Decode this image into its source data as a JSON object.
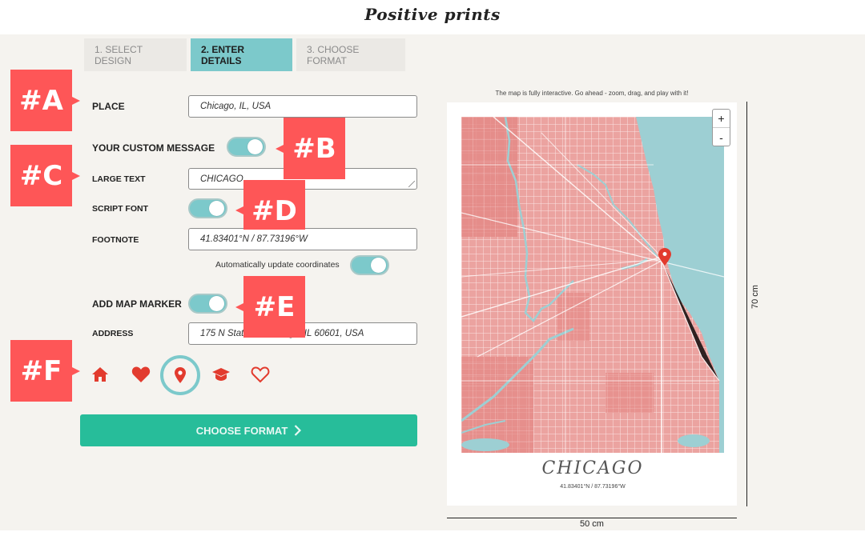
{
  "header": {
    "logo_text": "Positive prints"
  },
  "steps": [
    {
      "label": "1. SELECT DESIGN",
      "active": false
    },
    {
      "label": "2. ENTER DETAILS",
      "active": true
    },
    {
      "label": "3. CHOOSE FORMAT",
      "active": false
    }
  ],
  "form": {
    "place": {
      "label": "PLACE",
      "value": "Chicago, IL, USA"
    },
    "custom_message": {
      "label": "YOUR CUSTOM MESSAGE",
      "enabled": true
    },
    "large_text": {
      "label": "LARGE TEXT",
      "value": "CHICAGO"
    },
    "script_font": {
      "label": "SCRIPT FONT",
      "enabled": true
    },
    "footnote": {
      "label": "FOOTNOTE",
      "value": "41.83401°N / 87.73196°W"
    },
    "auto_update": {
      "label": "Automatically update coordinates",
      "enabled": true
    },
    "map_marker": {
      "label": "ADD MAP MARKER",
      "enabled": true
    },
    "address": {
      "label": "ADDRESS",
      "value": "175 N State St, Chicago, IL 60601, USA"
    },
    "marker_icons": [
      {
        "icon": "home-icon",
        "selected": false
      },
      {
        "icon": "heart-filled-icon",
        "selected": false
      },
      {
        "icon": "map-pin-icon",
        "selected": true
      },
      {
        "icon": "graduation-cap-icon",
        "selected": false
      },
      {
        "icon": "heart-outline-icon",
        "selected": false
      }
    ],
    "choose_format_button": "CHOOSE FORMAT"
  },
  "preview": {
    "note": "The map is fully interactive. Go ahead - zoom, drag, and play with it!",
    "zoom_in": "+",
    "zoom_out": "-",
    "poster_title": "CHICAGO",
    "poster_coords": "41.83401°N / 87.73196°W",
    "width_label": "50 cm",
    "height_label": "70 cm"
  },
  "annotations": [
    "#A",
    "#B",
    "#C",
    "#D",
    "#E",
    "#F"
  ],
  "colors": {
    "accent_teal": "#7cc9cb",
    "button_green": "#27bd9a",
    "marker_red": "#e23b2e",
    "callout_red": "#fe5657",
    "map_land": "#e58e8b",
    "map_water": "#9dcfd3"
  }
}
